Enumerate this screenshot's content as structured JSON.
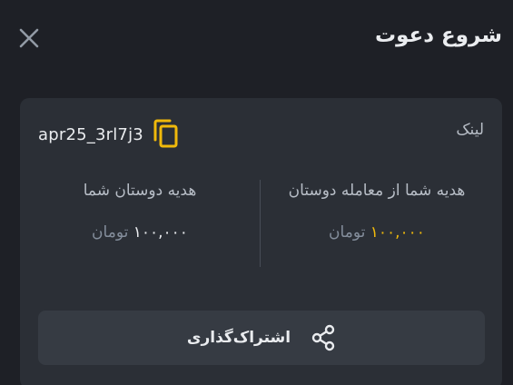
{
  "header": {
    "title": "شروع دعوت",
    "close_icon": "close-icon"
  },
  "card": {
    "link_label": "لینک",
    "link_code": "apr25_3rl7j3",
    "copy_icon": "copy-icon",
    "your_gift": {
      "title": "هدیه شما از معامله دوستان",
      "amount": "۱۰۰,۰۰۰",
      "unit": "تومان"
    },
    "friends_gift": {
      "title": "هدیه دوستان شما",
      "amount": "۱۰۰,۰۰۰",
      "unit": "تومان"
    },
    "share": {
      "label": "اشتراک‌گذاری",
      "icon": "share-icon"
    }
  },
  "colors": {
    "background": "#1e2026",
    "card": "#2b2f36",
    "button": "#363b43",
    "accent": "#f0b90b"
  }
}
